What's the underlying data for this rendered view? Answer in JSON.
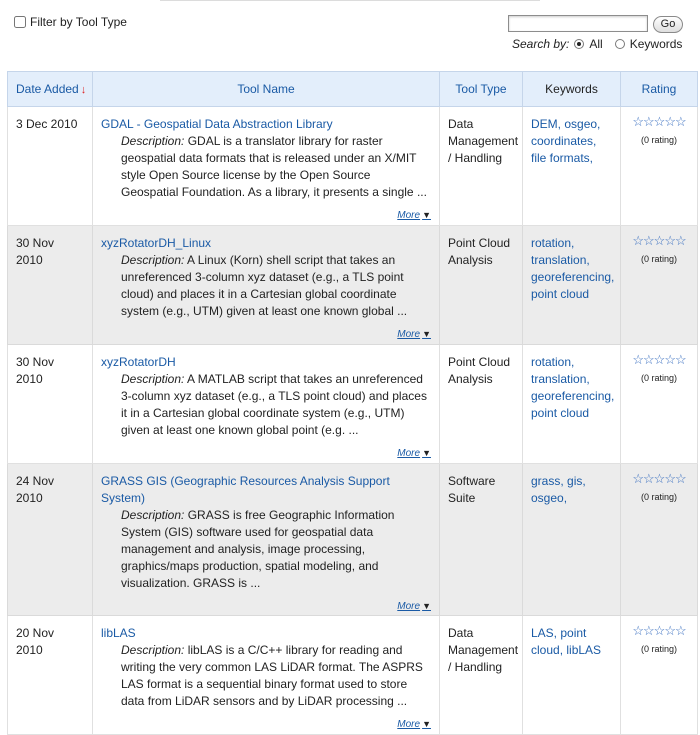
{
  "filter": {
    "label": "Filter by Tool Type",
    "checked": false
  },
  "search": {
    "value": "",
    "go_label": "Go",
    "by_label": "Search by:",
    "options": [
      {
        "label": "All",
        "selected": true
      },
      {
        "label": "Keywords",
        "selected": false
      }
    ]
  },
  "table": {
    "headers": {
      "date": "Date Added",
      "name": "Tool Name",
      "type": "Tool Type",
      "keywords": "Keywords",
      "rating": "Rating"
    },
    "sort_indicator": "↓",
    "rows": [
      {
        "date": "3 Dec 2010",
        "name": "GDAL - Geospatial Data Abstraction Library",
        "desc_label": "Description:",
        "desc": " GDAL is a translator library for raster geospatial data formats that is released under an X/MIT style Open Source license by the Open Source Geospatial Foundation. As a library, it presents a single ...",
        "more": "More",
        "type": "Data Management / Handling",
        "keywords": [
          "DEM,",
          "osgeo,",
          "coordinates,",
          "file formats,"
        ],
        "stars": "☆☆☆☆☆",
        "rating": "(0 rating)"
      },
      {
        "date": "30 Nov 2010",
        "name": "xyzRotatorDH_Linux",
        "desc_label": "Description:",
        "desc": " A Linux (Korn) shell script that takes an unreferenced 3-column xyz dataset (e.g., a TLS point cloud) and places it in a Cartesian global coordinate system (e.g., UTM) given at least one known global ...",
        "more": "More",
        "type": "Point Cloud Analysis",
        "keywords": [
          "rotation,",
          "translation,",
          "georeferencing,",
          "point cloud"
        ],
        "stars": "☆☆☆☆☆",
        "rating": "(0 rating)"
      },
      {
        "date": "30 Nov 2010",
        "name": "xyzRotatorDH",
        "desc_label": "Description:",
        "desc": " A MATLAB script that takes an unreferenced 3-column xyz dataset (e.g., a TLS point cloud) and places it in a Cartesian global coordinate system (e.g., UTM) given at least one known global point (e.g. ...",
        "more": "More",
        "type": "Point Cloud Analysis",
        "keywords": [
          "rotation,",
          "translation,",
          "georeferencing,",
          "point cloud"
        ],
        "stars": "☆☆☆☆☆",
        "rating": "(0 rating)"
      },
      {
        "date": "24 Nov 2010",
        "name": "GRASS GIS (Geographic Resources Analysis Support System)",
        "desc_label": "Description:",
        "desc": " GRASS is free Geographic Information System (GIS) software used for geospatial data management and analysis, image processing, graphics/maps production, spatial modeling, and visualization. GRASS is ...",
        "more": "More",
        "type": "Software Suite",
        "keywords": [
          "grass,",
          "gis,",
          "osgeo,"
        ],
        "stars": "☆☆☆☆☆",
        "rating": "(0 rating)"
      },
      {
        "date": "20 Nov 2010",
        "name": "libLAS",
        "desc_label": "Description:",
        "desc": " libLAS is a C/C++ library for reading and writing the very common LAS LiDAR format. The ASPRS LAS format is a sequential binary format used to store data from LiDAR sensors and by LiDAR processing ...",
        "more": "More",
        "type": "Data Management / Handling",
        "keywords": [
          "LAS,",
          "point cloud,",
          "libLAS"
        ],
        "stars": "☆☆☆☆☆",
        "rating": "(0 rating)"
      }
    ]
  }
}
